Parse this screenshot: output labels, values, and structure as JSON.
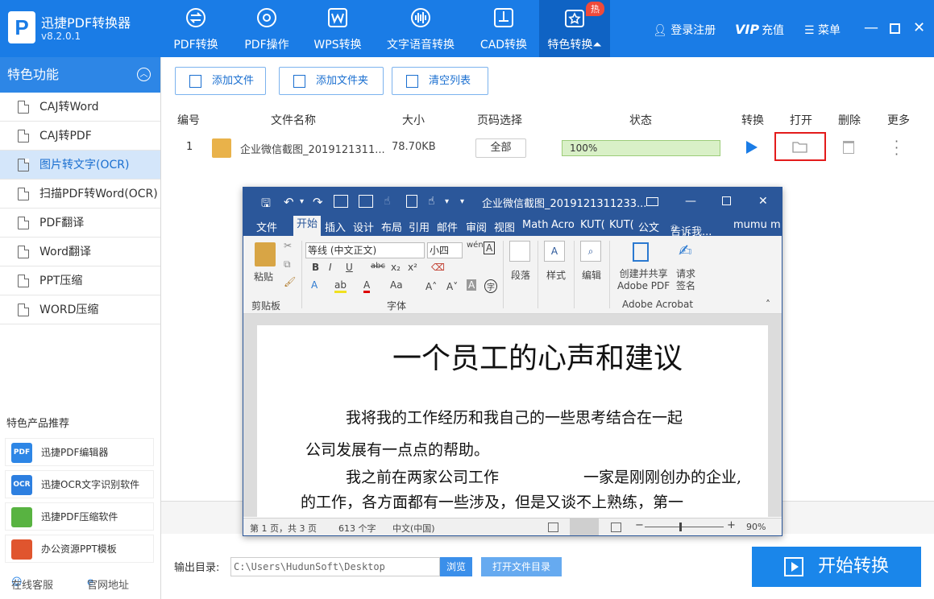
{
  "app": {
    "name": "迅捷PDF转换器",
    "version": "v8.2.0.1",
    "logo_letter": "P"
  },
  "nav": [
    {
      "label": "PDF转换",
      "icon": "swap-arrows-icon"
    },
    {
      "label": "PDF操作",
      "icon": "gear-icon"
    },
    {
      "label": "WPS转换",
      "icon": "wps-icon"
    },
    {
      "label": "文字语音转换",
      "icon": "soundwave-icon"
    },
    {
      "label": "CAD转换",
      "icon": "cad-icon"
    },
    {
      "label": "特色转换",
      "icon": "star-icon",
      "badge": "热",
      "active": true
    }
  ],
  "top_right": {
    "login": "登录注册",
    "vip_logo": "VIP",
    "vip": "充值",
    "menu": "菜单"
  },
  "sidebar": {
    "title": "特色功能",
    "items": [
      {
        "label": "CAJ转Word"
      },
      {
        "label": "CAJ转PDF"
      },
      {
        "label": "图片转文字(OCR)",
        "active": true
      },
      {
        "label": "扫描PDF转Word(OCR)"
      },
      {
        "label": "PDF翻译"
      },
      {
        "label": "Word翻译"
      },
      {
        "label": "PPT压缩"
      },
      {
        "label": "WORD压缩"
      }
    ],
    "rec_title": "特色产品推荐",
    "recs": [
      {
        "label": "迅捷PDF编辑器",
        "icon_text": "PDF",
        "color": "#2d86e6"
      },
      {
        "label": "迅捷OCR文字识别软件",
        "icon_text": "OCR",
        "color": "#2d7fe0"
      },
      {
        "label": "迅捷PDF压缩软件",
        "icon_text": "",
        "color": "#58b341"
      },
      {
        "label": "办公资源PPT模板",
        "icon_text": "",
        "color": "#e0552e"
      }
    ],
    "footer": {
      "service": "在线客服",
      "site": "官网地址"
    }
  },
  "toolbar": {
    "add_file": "添加文件",
    "add_folder": "添加文件夹",
    "clear": "清空列表"
  },
  "table": {
    "headers": {
      "index": "编号",
      "name": "文件名称",
      "size": "大小",
      "pages": "页码选择",
      "status": "状态",
      "convert": "转换",
      "open": "打开",
      "delete": "删除",
      "more": "更多"
    },
    "rows": [
      {
        "index": "1",
        "name": "企业微信截图_2019121311...",
        "size": "78.70KB",
        "pages": "全部",
        "progress_text": "100%",
        "progress": 1.0
      }
    ]
  },
  "bottom": {
    "output_label": "输出目录:",
    "output_path": "C:\\Users\\HudunSoft\\Desktop",
    "browse": "浏览",
    "open_dir": "打开文件目录",
    "start": "开始转换"
  },
  "word": {
    "title": "企业微信截图_2019121311233...",
    "tabs": [
      "文件",
      "开始",
      "插入",
      "设计",
      "布局",
      "引用",
      "邮件",
      "审阅",
      "视图",
      "Math",
      "Acro",
      "KUT(",
      "KUT(",
      "公文",
      "告诉我...",
      "mumu m"
    ],
    "ribbon": {
      "paste": "粘贴",
      "clipboard": "剪贴板",
      "font_name": "等线 (中文正文)",
      "font_size": "小四",
      "font_group": "字体",
      "paragraph": "段落",
      "styles": "样式",
      "editing": "编辑",
      "create_share": "创建并共享",
      "adobe_pdf": "Adobe PDF",
      "request": "请求",
      "sign": "签名",
      "acrobat": "Adobe Acrobat"
    },
    "doc": {
      "heading": "一个员工的心声和建议",
      "p1": "我将我的工作经历和我自己的一些思考结合在一起",
      "p2": "公司发展有一点点的帮助。",
      "p3a": "我之前在两家公司工作",
      "p3b": "一家是刚刚创办的企业,",
      "p4": "的工作，各方面都有一些涉及，但是又谈不上熟练，第一"
    },
    "status": {
      "page": "第 1 页，共 3 页",
      "words": "613 个字",
      "lang": "中文(中国)",
      "zoom": "90%"
    }
  }
}
